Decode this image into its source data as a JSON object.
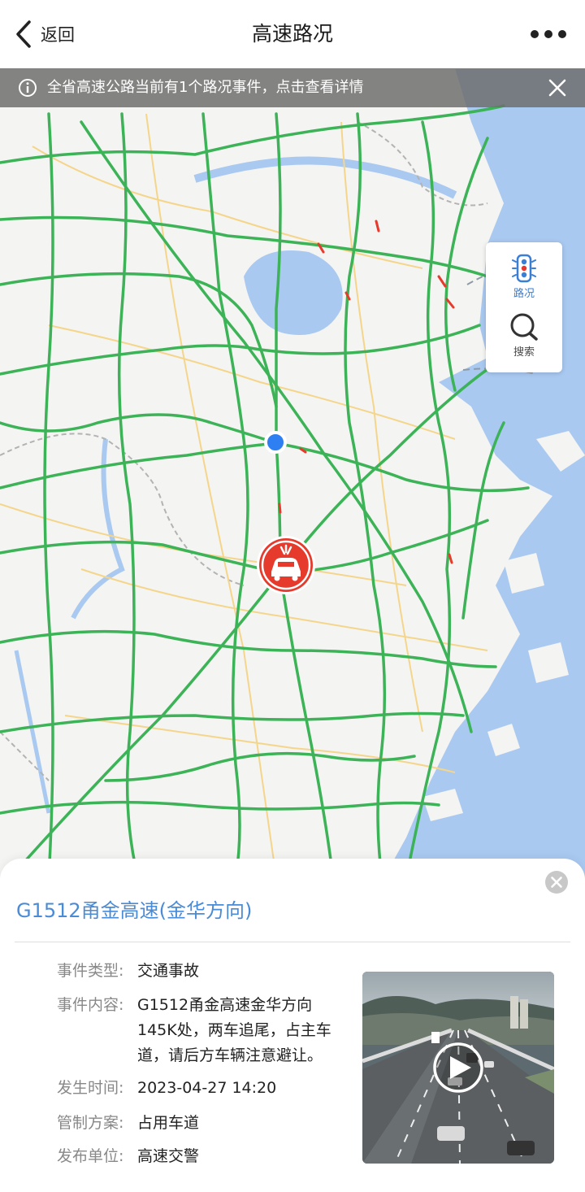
{
  "header": {
    "back_label": "返回",
    "title": "高速路况",
    "more_icon": "more-dots-icon"
  },
  "notice": {
    "text": "全省高速公路当前有1个路况事件，点击查看详情",
    "icon": "info-icon",
    "close_icon": "close-icon"
  },
  "side_panel": {
    "traffic_label": "路况",
    "search_label": "搜索"
  },
  "event": {
    "road_title": "G1512甬金高速(金华方向)",
    "rows": [
      {
        "label": "事件类型:",
        "value": "交通事故"
      },
      {
        "label": "事件内容:",
        "value": "G1512甬金高速金华方向145K处，两车追尾，占主车道，请后方车辆注意避让。"
      },
      {
        "label": "发生时间:",
        "value": "2023-04-27 14:20"
      },
      {
        "label": "管制方案:",
        "value": "占用车道"
      },
      {
        "label": "发布单位:",
        "value": "高速交警"
      }
    ]
  },
  "colors": {
    "accent": "#4a8bd6",
    "road_green": "#3cb357",
    "incident_red": "#e53a2c",
    "sea": "#a9c9f1"
  }
}
